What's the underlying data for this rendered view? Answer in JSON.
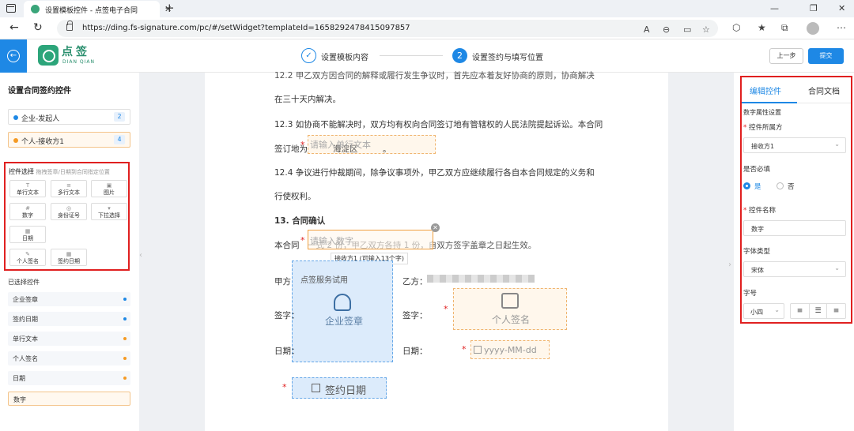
{
  "browser": {
    "tab_title": "设置模板控件 - 点签电子合同",
    "url": "https://ding.fs-signature.com/pc/#/setWidget?templateId=1658292478415097857"
  },
  "header": {
    "logo_name": "点签",
    "logo_sub": "DIAN QIAN",
    "step1": "设置模板内容",
    "step2_num": "2",
    "step2": "设置签约与填写位置",
    "prev": "上一步",
    "submit": "提交"
  },
  "left": {
    "title": "设置合同签约控件",
    "signers": [
      {
        "name": "企业-发起人",
        "count": "2",
        "color": "#1e88e5"
      },
      {
        "name": "个人-接收方1",
        "count": "4",
        "color": "#f59a23"
      }
    ],
    "controls_title": "控件选择",
    "controls_hint": "拖拽签章/日期到合同指定位置",
    "controls": [
      {
        "label": "单行文本",
        "icon": "T"
      },
      {
        "label": "多行文本",
        "icon": "≡"
      },
      {
        "label": "图片",
        "icon": "▣"
      },
      {
        "label": "数字",
        "icon": "#"
      },
      {
        "label": "身份证号",
        "icon": "◎"
      },
      {
        "label": "下拉选择",
        "icon": "▾"
      },
      {
        "label": "日期",
        "icon": "▦"
      },
      {
        "label": "个人签名",
        "icon": "✎"
      },
      {
        "label": "签约日期",
        "icon": "▦"
      }
    ],
    "selected_title": "已选择控件",
    "selected": [
      {
        "label": "企业签章",
        "color": "#1e88e5"
      },
      {
        "label": "签约日期",
        "color": "#1e88e5"
      },
      {
        "label": "单行文本",
        "color": "#f59a23"
      },
      {
        "label": "个人签名",
        "color": "#f59a23"
      },
      {
        "label": "日期",
        "color": "#f59a23"
      },
      {
        "label": "数字",
        "color": "#f59a23"
      }
    ]
  },
  "doc": {
    "line_top": "12.2 甲乙双方因合同的解释或履行发生争议时，首先应本着友好协商的原则，协商解决",
    "line1": "在三十天内解决。",
    "line2": "12.3  如协商不能解决时，双方均有权向合同签订地有管辖权的人民法院提起诉讼。本合同",
    "line3_prefix": "签订地为：",
    "line3_suffix": "。",
    "field_text_ph": "请输入单行文本",
    "field_text_under": "海淀区",
    "line4": "12.4  争议进行仲裁期间，除争议事项外，甲乙双方应继续履行各自本合同规定的义务和",
    "line5": "行使权利。",
    "section": "13. 合同确认",
    "line6_prefix": "本合同",
    "line6_suffix": "一式 2 份，甲乙双方各持 1 份，自双方签字盖章之日起生效。",
    "field_num_ph": "请输入数字",
    "field_num_tip": "接收方1 (可输入13个字)",
    "party_a_label": "甲方：",
    "party_a_value": "点签服务试用",
    "party_b_label": "乙方：",
    "sign_a": "签字：",
    "sign_b": "签字：",
    "date_a": "日期：",
    "date_b": "日期：",
    "seal_label": "企业签章",
    "personal_label": "个人签名",
    "date_ph": "yyyy-MM-dd",
    "signdate_label": "签约日期"
  },
  "right": {
    "tab1": "编辑控件",
    "tab2": "合同文档",
    "section": "数字属性设置",
    "owner_label": "控件所属方",
    "owner_value": "接收方1",
    "required_label": "是否必填",
    "yes": "是",
    "no": "否",
    "name_label": "控件名称",
    "name_value": "数字",
    "font_label": "字体类型",
    "font_value": "宋体",
    "size_label": "字号",
    "size_value": "小四"
  }
}
